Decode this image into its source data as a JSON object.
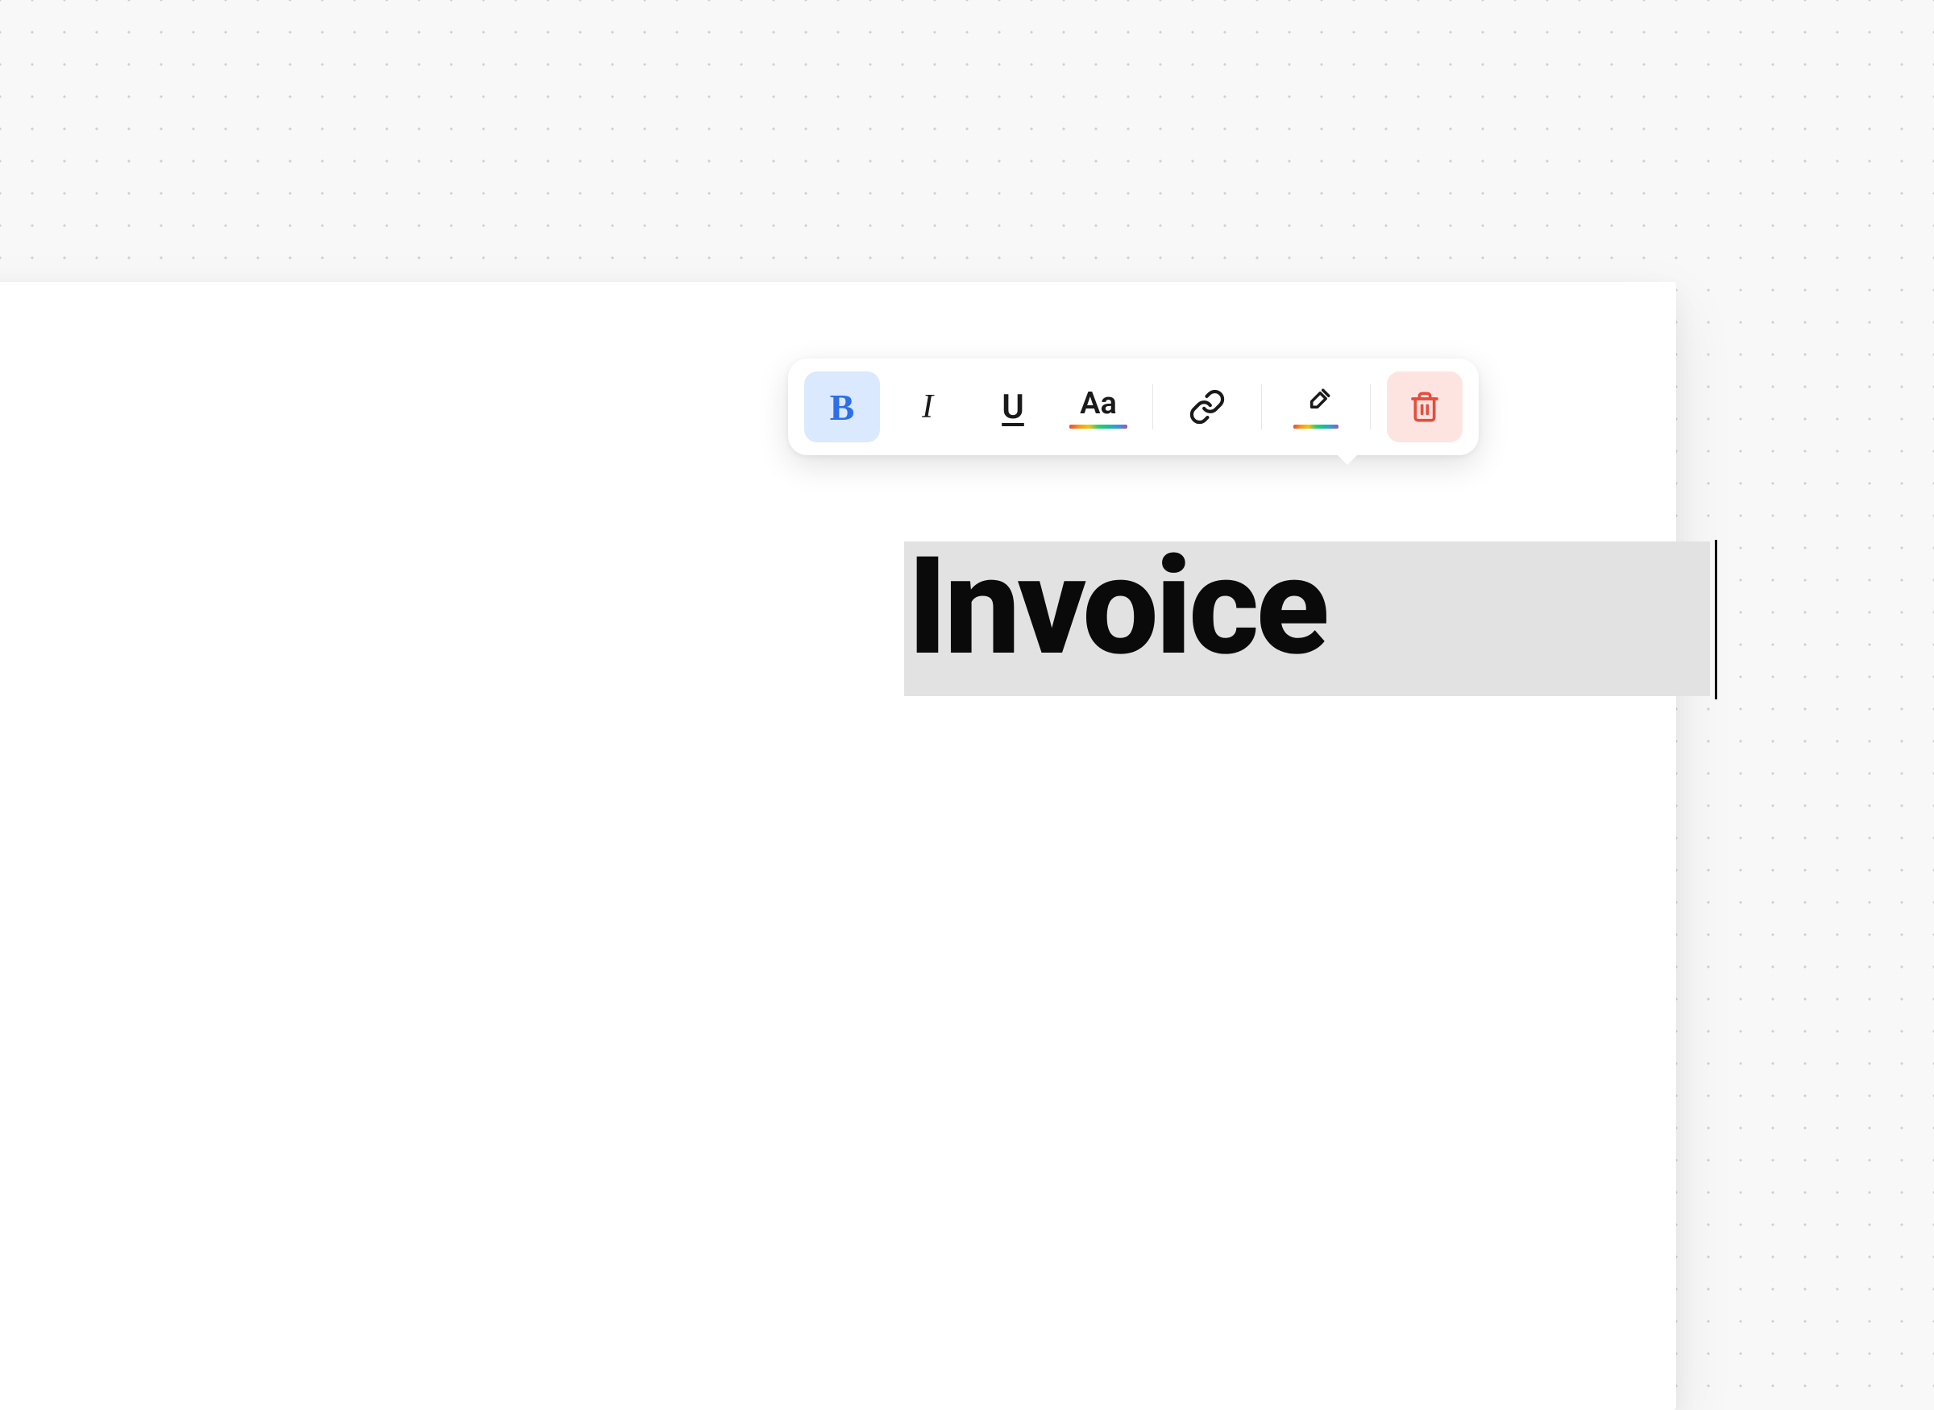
{
  "document": {
    "selected_text": "Invoice"
  },
  "toolbar": {
    "bold": {
      "glyph": "B",
      "active": true
    },
    "italic": {
      "glyph": "I"
    },
    "underline": {
      "glyph": "U"
    },
    "text_color": {
      "glyph": "Aa"
    }
  }
}
